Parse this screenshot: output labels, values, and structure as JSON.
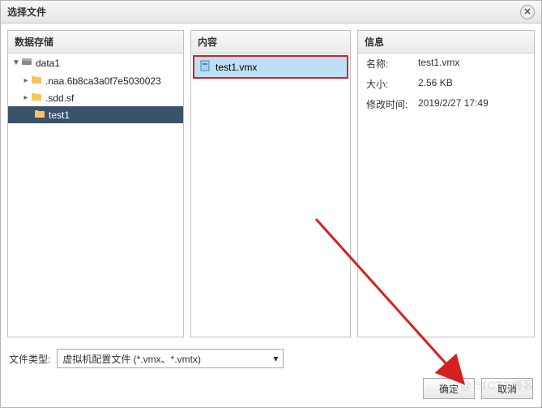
{
  "dialog": {
    "title": "选择文件"
  },
  "panels": {
    "left_header": "数据存储",
    "mid_header": "内容",
    "right_header": "信息"
  },
  "tree": {
    "root": "data1",
    "child1": ".naa.6b8ca3a0f7e5030023",
    "child2": ".sdd.sf",
    "child3": "test1"
  },
  "files": {
    "item1": "test1.vmx"
  },
  "info": {
    "name_label": "名称:",
    "name_value": "test1.vmx",
    "size_label": "大小:",
    "size_value": "2.56 KB",
    "mtime_label": "修改时间:",
    "mtime_value": "2019/2/27 17:49"
  },
  "filetype": {
    "label": "文件类型:",
    "selected": "虚拟机配置文件 (*.vmx、*.vmtx)"
  },
  "buttons": {
    "ok": "确定",
    "cancel": "取消"
  },
  "watermark": "@ 51CTO博客"
}
